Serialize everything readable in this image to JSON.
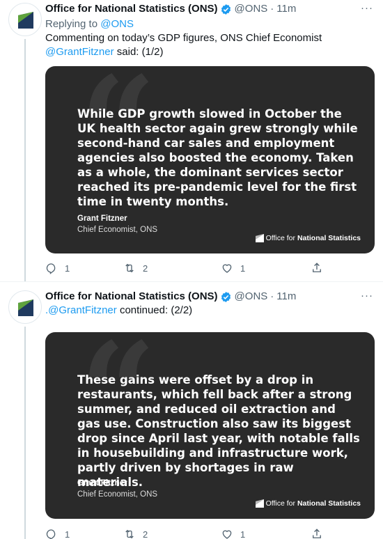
{
  "tweets": [
    {
      "name": "Office for National Statistics (ONS)",
      "handle": "@ONS",
      "dot": "·",
      "time": "11m",
      "more": "···",
      "replying_prefix": "Replying to",
      "replying_to": "@ONS",
      "text_before": "Commenting on today’s GDP figures, ONS Chief Economist",
      "text_mention": "@GrantFitzner",
      "text_after": "said: (1/2)",
      "quote": "While GDP growth slowed in October the UK health sector again grew strongly while second-hand car sales and employment agencies also boosted the economy. Taken as a whole, the dominant services sector reached its pre-pandemic level for the first time in twenty months.",
      "author": "Grant Fitzner",
      "role": "Chief Economist, ONS",
      "logo_text_a": "Office for",
      "logo_text_b": "National Statistics",
      "replies": "1",
      "retweets": "2",
      "likes": "1"
    },
    {
      "name": "Office for National Statistics (ONS)",
      "handle": "@ONS",
      "dot": "·",
      "time": "11m",
      "more": "···",
      "text_mention": ".@GrantFitzner",
      "text_after": "continued: (2/2)",
      "quote": "These gains were offset by a drop in restaurants, which fell back after a strong summer, and reduced oil extraction and gas use. Construction also saw its biggest drop since April last year, with notable falls in housebuilding and infrastructure work, partly driven by shortages in raw materials.",
      "author": "Grant Fitzner",
      "role": "Chief Economist, ONS",
      "logo_text_a": "Office for",
      "logo_text_b": "National Statistics",
      "replies": "1",
      "retweets": "2",
      "likes": "1"
    }
  ],
  "colors": {
    "accent": "#1d9bf0",
    "muted": "#536471",
    "card_bg": "#2a2a2a",
    "ons_dark": "#1f3a5f",
    "ons_green": "#5fa33d"
  }
}
